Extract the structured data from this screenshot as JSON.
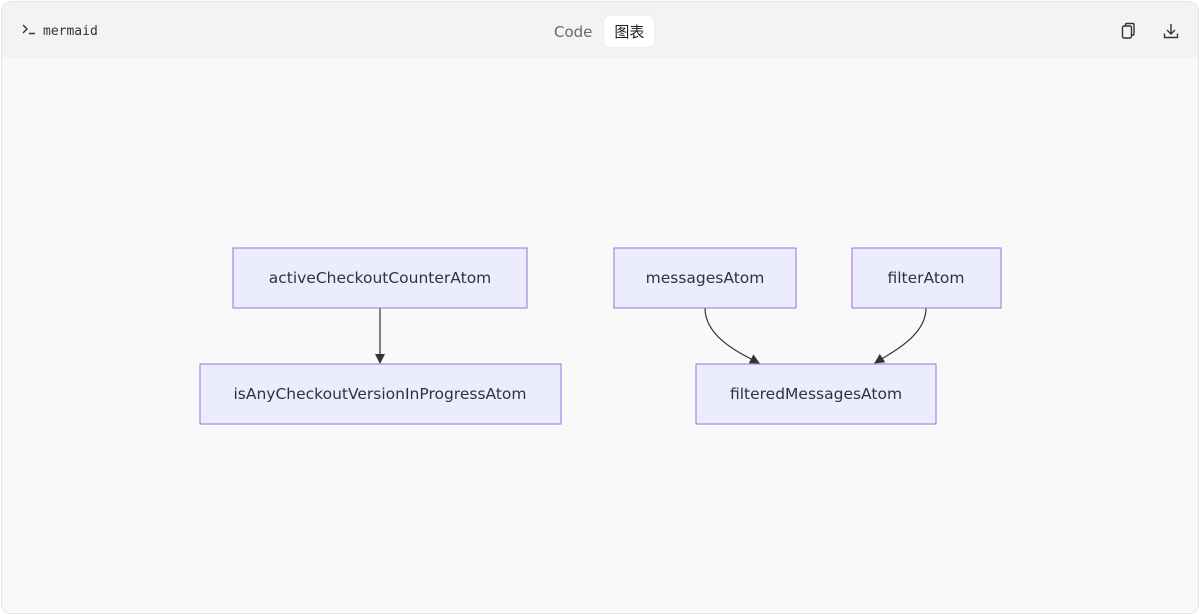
{
  "header": {
    "language_icon": "terminal-prompt-icon",
    "language_label": "mermaid",
    "tabs": [
      {
        "label": "Code",
        "active": false
      },
      {
        "label": "图表",
        "active": true
      }
    ],
    "actions": [
      {
        "icon": "copy-icon"
      },
      {
        "icon": "download-icon"
      }
    ]
  },
  "diagram": {
    "type": "flowchart",
    "nodes": [
      {
        "id": "activeCheckoutCounterAtom",
        "label": "activeCheckoutCounterAtom"
      },
      {
        "id": "isAnyCheckoutVersionInProgressAtom",
        "label": "isAnyCheckoutVersionInProgressAtom"
      },
      {
        "id": "messagesAtom",
        "label": "messagesAtom"
      },
      {
        "id": "filterAtom",
        "label": "filterAtom"
      },
      {
        "id": "filteredMessagesAtom",
        "label": "filteredMessagesAtom"
      }
    ],
    "edges": [
      {
        "from": "activeCheckoutCounterAtom",
        "to": "isAnyCheckoutVersionInProgressAtom"
      },
      {
        "from": "messagesAtom",
        "to": "filteredMessagesAtom"
      },
      {
        "from": "filterAtom",
        "to": "filteredMessagesAtom"
      }
    ],
    "colors": {
      "node_fill": "#ececff",
      "node_stroke": "#9370db",
      "edge": "#333333",
      "text": "#333333"
    }
  }
}
